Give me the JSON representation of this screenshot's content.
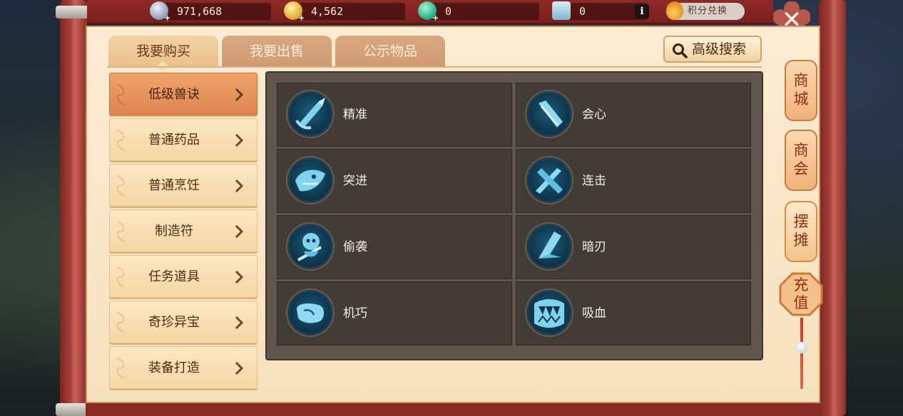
{
  "currencies": [
    {
      "icon": "silver-coin-icon",
      "value": "971,668"
    },
    {
      "icon": "gold-coin-icon",
      "value": "4,562"
    },
    {
      "icon": "jade-icon",
      "value": "0"
    },
    {
      "icon": "ticket-icon",
      "value": "0"
    }
  ],
  "top": {
    "info_glyph": "i",
    "points_exchange": "积分兑换",
    "close_glyph": "✕"
  },
  "tabs": [
    "我要购买",
    "我要出售",
    "公示物品"
  ],
  "advanced_search": "高级搜索",
  "categories": [
    "低级兽诀",
    "普通药品",
    "普通烹饪",
    "制造符",
    "任务道具",
    "奇珍异宝",
    "装备打造"
  ],
  "selected_category": "低级兽诀",
  "items": [
    {
      "name": "精准",
      "icon": "spear-skill-icon"
    },
    {
      "name": "会心",
      "icon": "blade-skill-icon"
    },
    {
      "name": "突进",
      "icon": "beast-charge-icon"
    },
    {
      "name": "连击",
      "icon": "twin-blade-icon"
    },
    {
      "name": "偷袭",
      "icon": "thief-skill-icon"
    },
    {
      "name": "暗刃",
      "icon": "dark-blade-icon"
    },
    {
      "name": "机巧",
      "icon": "fist-skill-icon"
    },
    {
      "name": "吸血",
      "icon": "fang-skill-icon"
    }
  ],
  "side_tabs": [
    {
      "line1": "商",
      "line2": "城"
    },
    {
      "line1": "商",
      "line2": "会"
    },
    {
      "line1": "摆",
      "line2": "摊"
    },
    {
      "line1": "充",
      "line2": "值"
    }
  ],
  "colors": {
    "panel": "#f6e1bd",
    "selected_category": "#de8450",
    "grid_bg": "#433c36",
    "frame_red": "#8e2a26"
  }
}
